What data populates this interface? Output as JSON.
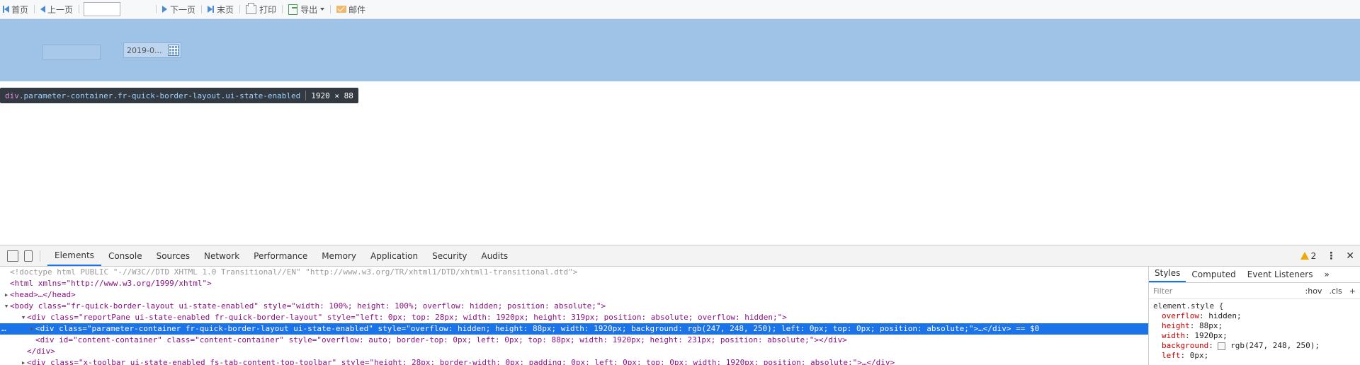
{
  "toolbar": {
    "first": "首页",
    "prev": "上一页",
    "page_value": "",
    "next": "下一页",
    "last": "末页",
    "print": "打印",
    "export": "导出",
    "mail": "邮件"
  },
  "params": {
    "date_value": "2019-0..."
  },
  "inspect_tooltip": {
    "tag": "div",
    "classes": ".parameter-container.fr-quick-border-layout.ui-state-enabled",
    "size": "1920 × 88"
  },
  "devtools": {
    "tabs": [
      "Elements",
      "Console",
      "Sources",
      "Network",
      "Performance",
      "Memory",
      "Application",
      "Security",
      "Audits"
    ],
    "warnings": "2",
    "lines": [
      {
        "text": "<!doctype html PUBLIC \"-//W3C//DTD XHTML 1.0 Transitional//EN\" \"http://www.w3.org/TR/xhtml1/DTD/xhtml1-transitional.dtd\">"
      },
      {
        "text": "<html xmlns=\"http://www.w3.org/1999/xhtml\">"
      },
      {
        "text": "<head>…</head>"
      },
      {
        "text": "<body class=\"fr-quick-border-layout ui-state-enabled\" style=\"width: 100%; height: 100%; overflow: hidden; position: absolute;\">"
      },
      {
        "text": "<div class=\"reportPane ui-state-enabled fr-quick-border-layout\" style=\"left: 0px; top: 28px; width: 1920px; height: 319px; position: absolute; overflow: hidden;\">"
      },
      {
        "text": "<div class=\"parameter-container fr-quick-border-layout ui-state-enabled\" style=\"overflow: hidden; height: 88px; width: 1920px; background: rgb(247, 248, 250); left: 0px; top: 0px; position: absolute;\">…</div> == $0"
      },
      {
        "text": "<div id=\"content-container\" class=\"content-container\" style=\"overflow: auto; border-top: 0px; left: 0px; top: 88px; width: 1920px; height: 231px; position: absolute;\"></div>"
      },
      {
        "text": "</div>"
      },
      {
        "text": "<div class=\"x-toolbar ui-state-enabled fs-tab-content-top-toolbar\" style=\"height: 28px; border-width: 0px; padding: 0px; left: 0px; top: 0px; width: 1920px; position: absolute;\">…</div>"
      }
    ],
    "styles": {
      "tabs": [
        "Styles",
        "Computed",
        "Event Listeners"
      ],
      "more": "»",
      "filter_placeholder": "Filter",
      "hov": ":hov",
      "cls": ".cls",
      "add": "+",
      "selector": "element.style {",
      "props": [
        {
          "name": "overflow",
          "value": "hidden;"
        },
        {
          "name": "height",
          "value": "88px;"
        },
        {
          "name": "width",
          "value": "1920px;"
        },
        {
          "name": "background",
          "value": "rgb(247, 248, 250);"
        },
        {
          "name": "left",
          "value": "0px;"
        }
      ]
    }
  }
}
